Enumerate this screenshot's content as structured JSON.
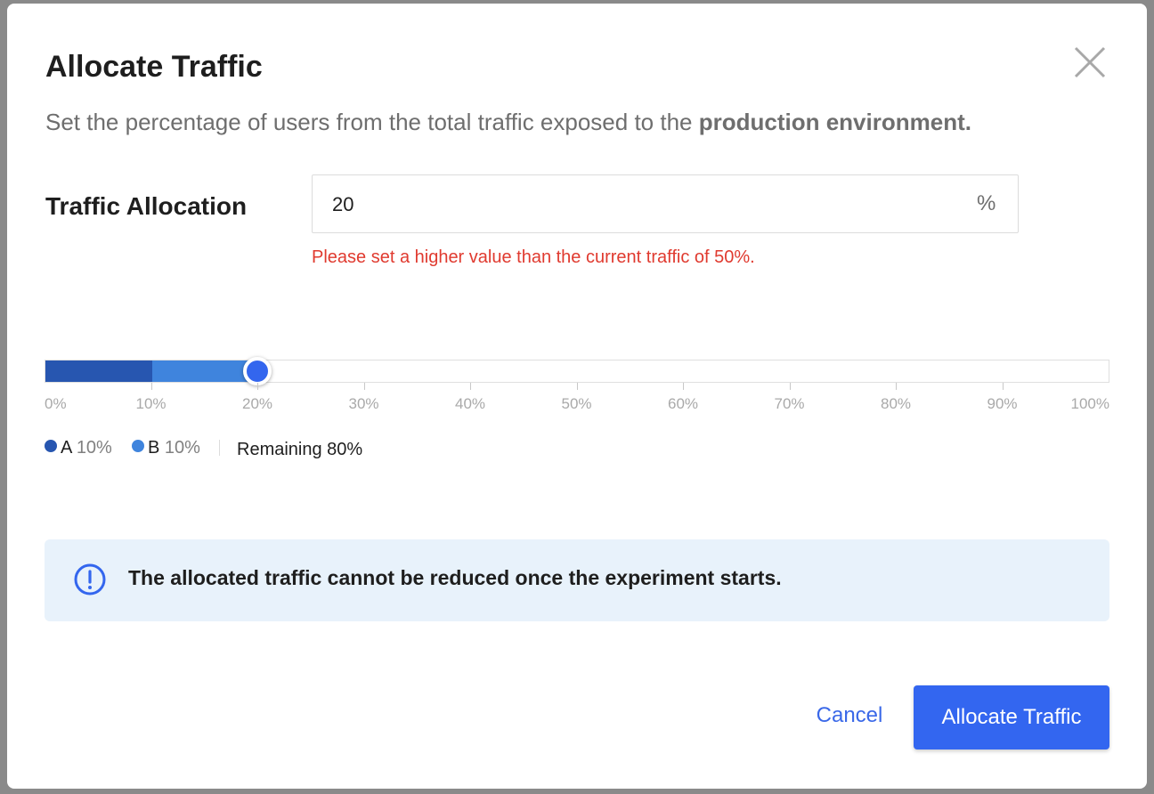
{
  "dialog": {
    "title": "Allocate Traffic",
    "subtitle_prefix": "Set the percentage of users from the total traffic exposed to the ",
    "subtitle_bold": "production environment.",
    "close_icon": "close-icon"
  },
  "traffic_field": {
    "label": "Traffic Allocation",
    "value": "20",
    "suffix": "%",
    "error": "Please set a higher value than the current traffic of 50%."
  },
  "slider": {
    "value_percent": 20,
    "segments": [
      {
        "name": "A",
        "percent": 10,
        "color": "#2756b0"
      },
      {
        "name": "B",
        "percent": 10,
        "color": "#3f84dd"
      }
    ],
    "thumb_color": "#3366ee",
    "tick_labels": [
      "0%",
      "10%",
      "20%",
      "30%",
      "40%",
      "50%",
      "60%",
      "70%",
      "80%",
      "90%",
      "100%"
    ]
  },
  "legend": {
    "items": [
      {
        "name": "A",
        "value": "10%",
        "color": "#2756b0"
      },
      {
        "name": "B",
        "value": "10%",
        "color": "#3f84dd"
      }
    ],
    "remaining": "Remaining 80%"
  },
  "info": {
    "icon": "info-icon",
    "text": "The allocated traffic cannot be reduced once the experiment starts.",
    "color": "#3366ee"
  },
  "actions": {
    "cancel_label": "Cancel",
    "primary_label": "Allocate Traffic",
    "primary_color": "#3366f0"
  }
}
